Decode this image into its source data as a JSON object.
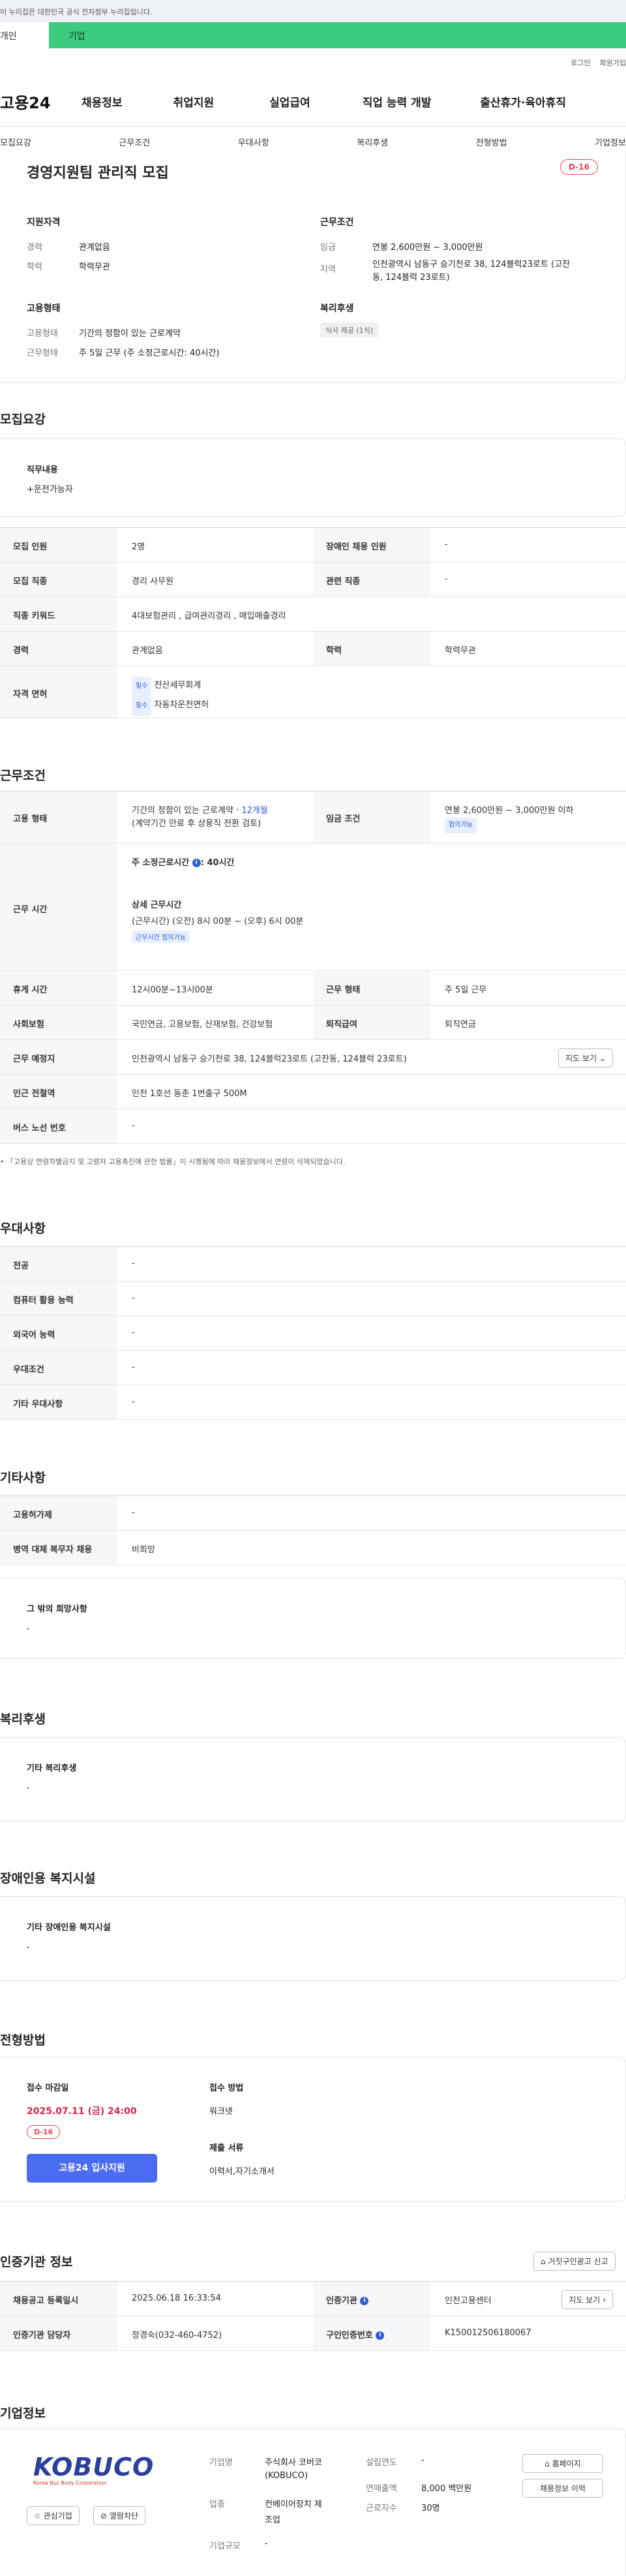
{
  "gov_banner": "이 누리집은 대한민국 공식 전자정부 누리집입니다.",
  "top_tabs": {
    "individual": "개인",
    "corporate": "기업"
  },
  "top_links": [
    "로그인",
    "회원가입"
  ],
  "logo": "고용24",
  "gnb": [
    "채용정보",
    "취업지원",
    "실업급여",
    "직업 능력 개발",
    "출산휴가·육아휴직"
  ],
  "subnav": [
    "모집요강",
    "근무조건",
    "우대사항",
    "복리후생",
    "전형방법",
    "기업정보"
  ],
  "job": {
    "title": "경영지원팀 관리직 모집",
    "dday": "D-16",
    "support_heading": "지원자격",
    "career_label": "경력",
    "career_value": "관계없음",
    "edu_label": "학력",
    "edu_value": "학력무관",
    "cond_heading": "근무조건",
    "wage_label": "임금",
    "wage_value": "연봉 2,600만원 ~ 3,000만원",
    "area_label": "지역",
    "area_value_1": "인천광역시 남동구 승기천로 38, 124블럭23로트 (고잔",
    "area_value_2": "동, 124블럭 23로트)",
    "emp_heading": "고용형태",
    "emp_label": "고용형태",
    "emp_value": "기간의 정함이 있는 근로계약",
    "worktype_label": "근무형태",
    "worktype_value": "주 5일 근무 (주 소정근로시간: 40시간)",
    "welfare_heading": "복리후생",
    "welfare_tag": "식사 제공 (1식)"
  },
  "recruit": {
    "heading": "모집요강",
    "duty_label": "직무내용",
    "duty_value": "+운전가능자",
    "rows": {
      "people_label": "모집 인원",
      "people_value": "2명",
      "disabled_label": "장애인 채용 인원",
      "disabled_value": "-",
      "job_label": "모집 직종",
      "job_value": "경리 사무원",
      "related_label": "관련 직종",
      "related_value": "-",
      "keyword_label": "직종 키워드",
      "keyword_value": "4대보험관리 , 급여관리경리 , 매입매출경리",
      "career_label": "경력",
      "career_value": "관계없음",
      "edu_label": "학력",
      "edu_value": "학력무관",
      "license_label": "자격 면허",
      "license_1_tag": "필수",
      "license_1": "전산세무회계",
      "license_2_tag": "필수",
      "license_2": "자동차운전면허"
    }
  },
  "work": {
    "heading": "근무조건",
    "emp_label": "고용 형태",
    "emp_value_1a": "기간의 정함이 있는 근로계약 · ",
    "emp_value_1b": "12개월",
    "emp_value_2": "(계약기간 만료 후 상용직 전환 검토)",
    "wage_label": "임금 조건",
    "wage_value": "연봉 2,600만원 ~ 3,000만원 이하",
    "wage_chip": "협의가능",
    "hours_label": "근무 시간",
    "hours_std_a": "주 소정근로시간",
    "hours_std_b": ": 40시간",
    "hours_detail_h": "상세 근무시간",
    "hours_detail_v": "(근무시간) (오전) 8시 00분 ~ (오후) 6시 00분",
    "hours_chip": "근무시간 협의가능",
    "break_label": "휴게 시간",
    "break_value": "12시00분~13시00분",
    "shift_label": "근무 형태",
    "shift_value": "주 5일 근무",
    "insurance_label": "사회보험",
    "insurance_value": "국민연금, 고용보험, 산재보험, 건강보험",
    "retire_label": "퇴직급여",
    "retire_value": "퇴직연금",
    "place_label": "근무 예정지",
    "place_value": "인천광역시 남동구 승기천로 38, 124블럭23로트 (고잔동, 124블럭 23로트)",
    "map_btn": "지도 보기",
    "subway_label": "인근 전철역",
    "subway_value": "인천 1호선 동춘 1번출구 500M",
    "bus_label": "버스 노선 번호",
    "bus_value": "-",
    "note": "「고용상 연령차별금지 및 고령자 고용촉진에 관한 법률」이 시행됨에 따라 채용정보에서 연령이 삭제되었습니다."
  },
  "pref": {
    "heading": "우대사항",
    "rows": [
      [
        "전공",
        "-"
      ],
      [
        "컴퓨터 활용 능력",
        "-"
      ],
      [
        "외국어 능력",
        "-"
      ],
      [
        "우대조건",
        "-"
      ],
      [
        "기타 우대사항",
        "-"
      ]
    ]
  },
  "etc": {
    "heading": "기타사항",
    "rows": [
      [
        "고용허가제",
        "-"
      ],
      [
        "병역 대체 복무자 채용",
        "비희망"
      ]
    ],
    "other_label": "그 밖의 희망사항",
    "other_value": "-"
  },
  "benefit": {
    "heading": "복리후생",
    "label": "기타 복리후생",
    "value": "-"
  },
  "facility": {
    "heading": "장애인용 복지시설",
    "label": "기타 장애인용 복지시설",
    "value": "-"
  },
  "selection": {
    "heading": "전형방법",
    "deadline_label": "접수 마감일",
    "deadline_value": "2025.07.11 (금) 24:00",
    "dday": "D-16",
    "apply_btn": "고용24 입사지원",
    "method_label": "접수 방법",
    "method_value": "워크넷",
    "docs_label": "제출 서류",
    "docs_value": "이력서,자기소개서"
  },
  "auth": {
    "heading": "인증기관 정보",
    "report_btn": "거짓구인광고 신고",
    "reg_label": "채용공고 등록일시",
    "reg_value": "2025.06.18 16:33:54",
    "org_label": "인증기관",
    "org_value": "인천고용센터",
    "map_btn": "지도 보기",
    "manager_label": "인증기관 담당자",
    "manager_value": "정경숙(032-460-4752)",
    "no_label": "구인인증번호",
    "no_value": "K150012506180067"
  },
  "company": {
    "heading": "기업정보",
    "logo_text": "KOBUCO",
    "logo_sub": "Korea Bus Body Corporation",
    "fav_btn": "관심기업",
    "block_btn": "열람차단",
    "name_label": "기업명",
    "name_value_1": "주식회사 코버코",
    "name_value_2": "(KOBUCO)",
    "industry_label": "업종",
    "industry_value_1": "컨베이어장치 제",
    "industry_value_2": "조업",
    "size_label": "기업규모",
    "size_value": "-",
    "year_label": "설립연도",
    "year_value": "-",
    "sales_label": "연매출액",
    "sales_value": "8,000 백만원",
    "staff_label": "근로자수",
    "staff_value": "30명",
    "home_btn": "홈페이지",
    "jobs_btn": "채용정보 이력"
  },
  "colors": {
    "accent": "#2c5fd6",
    "green": "#3ccb7f",
    "danger": "#d9254b"
  }
}
